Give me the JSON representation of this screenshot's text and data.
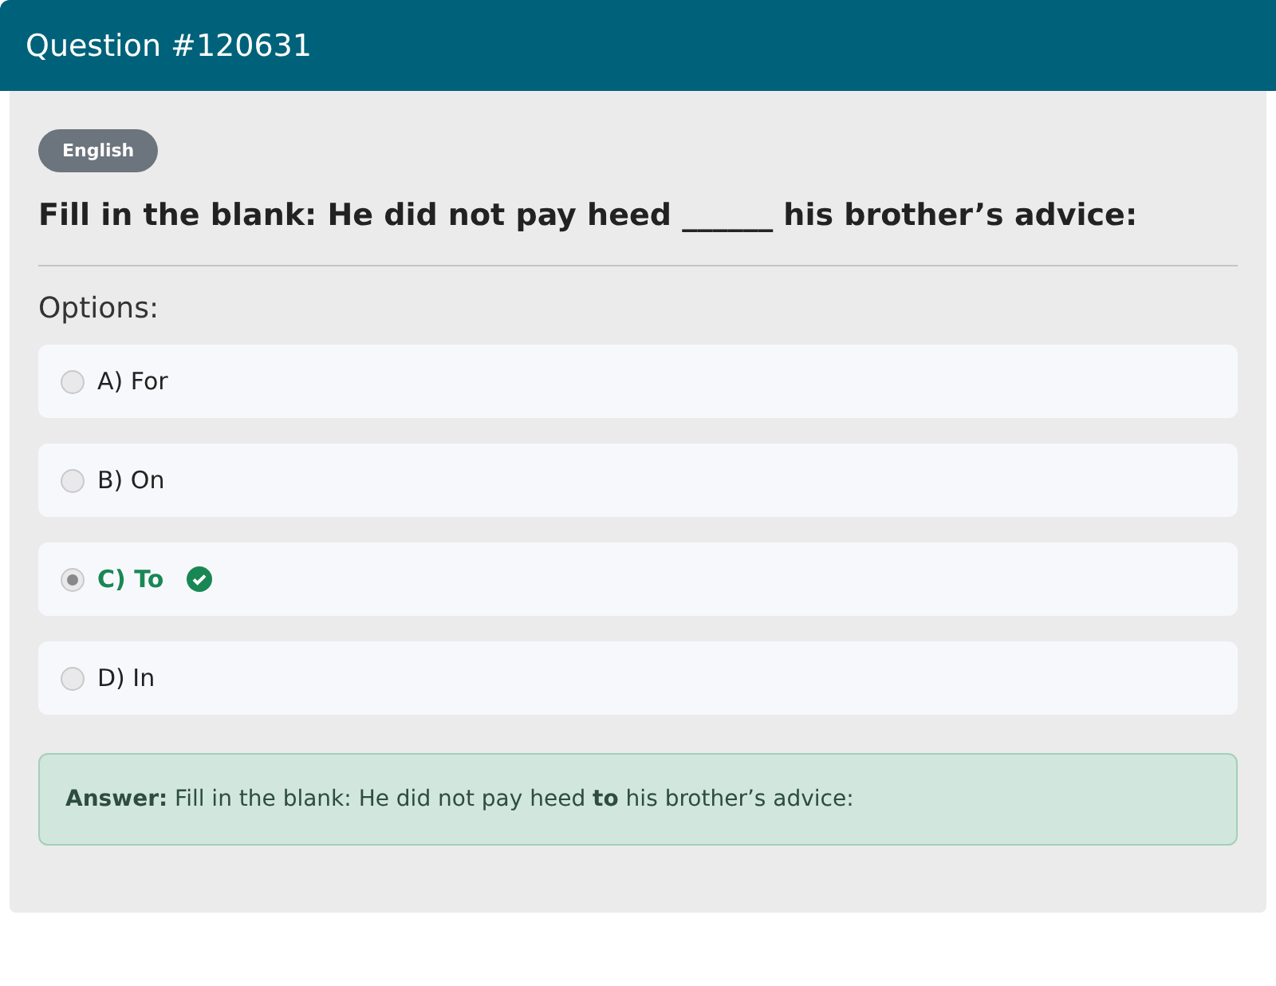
{
  "header": {
    "title": "Question #120631"
  },
  "tag": "English",
  "question": "Fill in the blank: He did not pay heed ______ his brother’s advice:",
  "options_label": "Options:",
  "options": [
    {
      "label": "A) For",
      "selected": false,
      "correct": false
    },
    {
      "label": "B) On",
      "selected": false,
      "correct": false
    },
    {
      "label": "C) To",
      "selected": true,
      "correct": true
    },
    {
      "label": "D) In",
      "selected": false,
      "correct": false
    }
  ],
  "answer": "**Answer:** Fill in the blank: He did not pay heed **to** his brother’s advice:"
}
